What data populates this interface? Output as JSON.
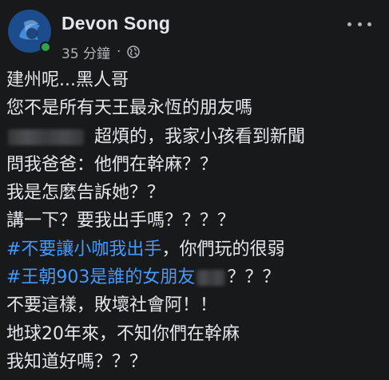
{
  "post": {
    "author": {
      "name": "Devon Song",
      "online": true
    },
    "timestamp": "35 分鐘",
    "separator": "·",
    "privacy_icon": "globe-icon",
    "more_icon": "more-options-icon",
    "lines": [
      {
        "text": "建州呢...黑人哥"
      },
      {
        "text": "您不是所有天王最永恆的朋友嗎"
      },
      {
        "text": "超煩的，我家小孩看到新聞"
      },
      {
        "text": "問我爸爸：他們在幹麻？？"
      },
      {
        "text": "我是怎麼告訴她？？"
      },
      {
        "text": "講一下？要我出手嗎？？？？"
      },
      {
        "hashtag": "#不要讓小咖我出手",
        "text": "，你們玩的很弱"
      },
      {
        "hashtag": "#王朝903是誰的女朋友",
        "text": "？？？"
      },
      {
        "text": "不要這樣，敗壞社會阿！！"
      },
      {
        "text": "地球20年來，不知你們在幹麻"
      },
      {
        "text": "我知道好嗎？？？"
      }
    ]
  },
  "colors": {
    "background": "#18191a",
    "text": "#e4e6eb",
    "secondary_text": "#b0b3b8",
    "hashtag": "#4599ff",
    "online": "#31a24c"
  }
}
